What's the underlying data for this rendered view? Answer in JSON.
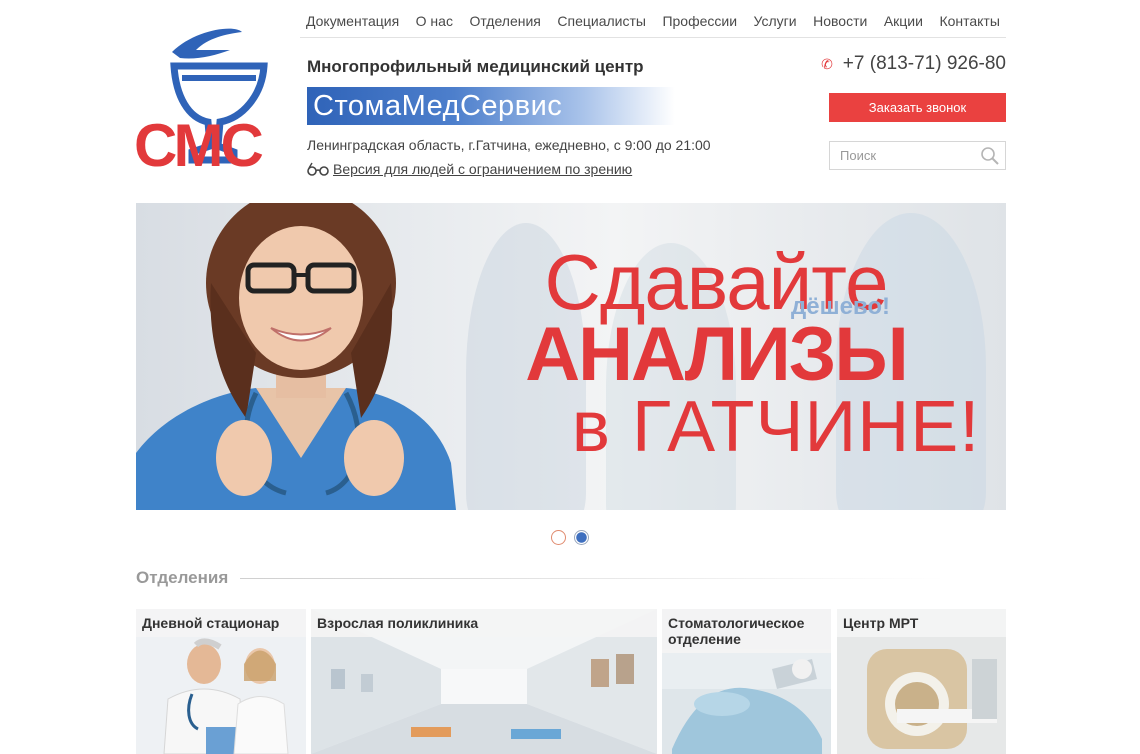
{
  "nav": {
    "items": [
      {
        "label": "Документация"
      },
      {
        "label": "О нас"
      },
      {
        "label": "Отделения"
      },
      {
        "label": "Специалисты"
      },
      {
        "label": "Профессии"
      },
      {
        "label": "Услуги"
      },
      {
        "label": "Новости"
      },
      {
        "label": "Акции"
      },
      {
        "label": "Контакты"
      }
    ]
  },
  "logo": {
    "text": "СМС",
    "icon": "bowl-of-hygieia-icon"
  },
  "header": {
    "org_title": "Многопрофильный медицинский центр",
    "brand_name": "СтомаМедСервис",
    "address": "Ленинградская область, г.Гатчина, ежедневно, с 9:00 до 21:00",
    "accessible_version": "Версия для людей с ограничением по зрению",
    "accessible_icon": "glasses-icon"
  },
  "contact": {
    "phone": "+7 (813-71) 926-80",
    "phone_icon": "phone-icon",
    "call_button": "Заказать звонок"
  },
  "search": {
    "placeholder": "Поиск",
    "icon": "search-icon"
  },
  "banner": {
    "line1": "Сдавайте",
    "tagline": "дёшево!",
    "line2": "АНАЛИЗЫ",
    "line3": "в ГАТЧИНЕ!"
  },
  "slider": {
    "count": 2,
    "active_index": 1
  },
  "departments": {
    "heading": "Отделения",
    "cards": [
      {
        "title": "Дневной стационар"
      },
      {
        "title": "Взрослая поликлиника"
      },
      {
        "title": "Стоматологическое отделение"
      },
      {
        "title": "Центр МРТ"
      }
    ]
  },
  "colors": {
    "accent_red": "#ea4140",
    "brand_blue": "#2f63b8",
    "nav_text": "#4a4a4a"
  }
}
